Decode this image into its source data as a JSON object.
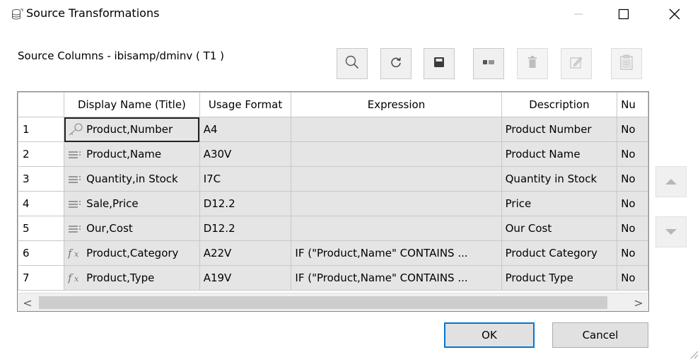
{
  "window": {
    "title": "Source Transformations",
    "icon": "database-table-icon"
  },
  "header": {
    "source_label": "Source Columns - ibisamp/dminv ( T1 )"
  },
  "toolbar": [
    {
      "name": "search-icon",
      "enabled": true
    },
    {
      "name": "refresh-icon",
      "enabled": true
    },
    {
      "name": "save-icon",
      "enabled": true
    },
    {
      "name": "properties-icon",
      "enabled": true
    },
    {
      "name": "delete-icon",
      "enabled": false
    },
    {
      "name": "edit-icon",
      "enabled": false
    },
    {
      "name": "paste-icon",
      "enabled": false
    }
  ],
  "grid": {
    "columns": [
      "",
      "Display Name (Title)",
      "Usage Format",
      "Expression",
      "Description",
      "Nu"
    ],
    "rows": [
      {
        "num": "1",
        "icon": "key-icon",
        "name": "Product,Number",
        "format": "A4",
        "expression": "",
        "description": "Product Number",
        "nu": "No"
      },
      {
        "num": "2",
        "icon": "list-icon",
        "name": "Product,Name",
        "format": "A30V",
        "expression": "",
        "description": "Product Name",
        "nu": "No"
      },
      {
        "num": "3",
        "icon": "list-icon",
        "name": "Quantity,in Stock",
        "format": "I7C",
        "expression": "",
        "description": "Quantity in Stock",
        "nu": "No"
      },
      {
        "num": "4",
        "icon": "list-icon",
        "name": "Sale,Price",
        "format": "D12.2",
        "expression": "",
        "description": "Price",
        "nu": "No"
      },
      {
        "num": "5",
        "icon": "list-icon",
        "name": "Our,Cost",
        "format": "D12.2",
        "expression": "",
        "description": "Our Cost",
        "nu": "No"
      },
      {
        "num": "6",
        "icon": "function-icon",
        "name": "Product,Category",
        "format": "A22V",
        "expression": "IF (\"Product,Name\" CONTAINS ...",
        "description": "Product Category",
        "nu": "No"
      },
      {
        "num": "7",
        "icon": "function-icon",
        "name": "Product,Type",
        "format": "A19V",
        "expression": "IF (\"Product,Name\" CONTAINS ...",
        "description": "Product Type",
        "nu": "No"
      }
    ],
    "scroll_left": "<",
    "scroll_right": ">"
  },
  "buttons": {
    "ok": "OK",
    "cancel": "Cancel"
  }
}
